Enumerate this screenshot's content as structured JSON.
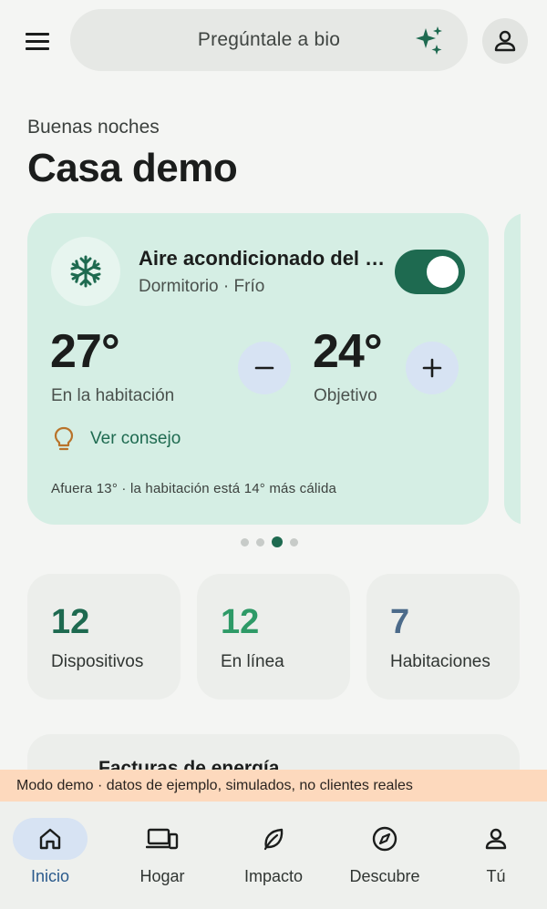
{
  "header": {
    "search_placeholder": "Pregúntale a bio"
  },
  "greeting": "Buenas noches",
  "home_title": "Casa demo",
  "device_card": {
    "title": "Aire acondicionado del dormitorio",
    "subtitle": "Dormitorio · Frío",
    "power_on": true,
    "current_temp": "27°",
    "current_label": "En la habitación",
    "target_temp": "24°",
    "target_label": "Objetivo",
    "tip_label": "Ver consejo",
    "footer": "Afuera 13° · la habitación está 14° más cálida"
  },
  "pager": {
    "count": 4,
    "active_index": 2
  },
  "stats": [
    {
      "value": "12",
      "label": "Dispositivos",
      "color": "#1e6a50"
    },
    {
      "value": "12",
      "label": "En línea",
      "color": "#2e9a67"
    },
    {
      "value": "7",
      "label": "Habitaciones",
      "color": "#4c6b8a"
    }
  ],
  "energy_card": {
    "title": "Facturas de energía"
  },
  "demo_banner": "Modo demo · datos de ejemplo, simulados, no clientes reales",
  "nav": [
    {
      "label": "Inicio",
      "icon": "home-icon",
      "active": true
    },
    {
      "label": "Hogar",
      "icon": "devices-icon",
      "active": false
    },
    {
      "label": "Impacto",
      "icon": "leaf-icon",
      "active": false
    },
    {
      "label": "Descubre",
      "icon": "compass-icon",
      "active": false
    },
    {
      "label": "Tú",
      "icon": "person-icon",
      "active": false
    }
  ],
  "colors": {
    "accent": "#1e6a50",
    "card_bg": "#d5eee4",
    "control_bg": "#d7e3f3",
    "banner_bg": "#fdd9bd",
    "active_nav": "#2a5a8c",
    "tip_icon": "#b9732a"
  }
}
